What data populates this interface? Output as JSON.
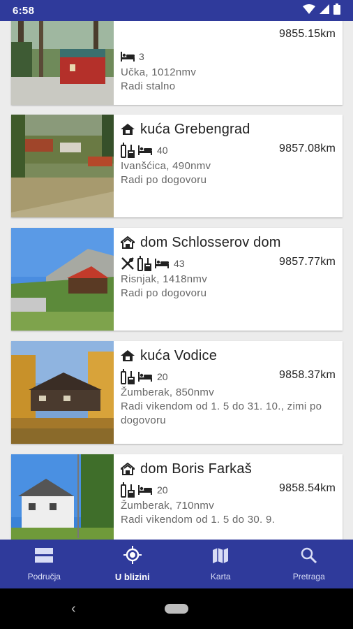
{
  "status_bar": {
    "time": "6:58"
  },
  "cards": [
    {
      "title": "",
      "amenities": [
        "bed"
      ],
      "beds": "3",
      "distance": "9855.15km",
      "location": "Učka, 1012nmv",
      "hours": "Radi stalno",
      "type_icon": "",
      "photo": "cabin-forest"
    },
    {
      "title": "kuća Grebengrad",
      "amenities": [
        "drinks",
        "bed"
      ],
      "beds": "40",
      "distance": "9857.08km",
      "location": "Ivanšćica, 490nmv",
      "hours": "Radi po dogovoru",
      "type_icon": "house-icon",
      "photo": "village-hills"
    },
    {
      "title": "dom Schlosserov dom",
      "amenities": [
        "food",
        "drinks",
        "bed"
      ],
      "beds": "43",
      "distance": "9857.77km",
      "location": "Risnjak, 1418nmv",
      "hours": "Radi po dogovoru",
      "type_icon": "lodge-icon",
      "photo": "mountain-hut"
    },
    {
      "title": "kuća Vodice",
      "amenities": [
        "drinks",
        "bed"
      ],
      "beds": "20",
      "distance": "9858.37km",
      "location": "Žumberak, 850nmv",
      "hours": "Radi vikendom od 1. 5 do 31. 10., zimi po dogovoru",
      "type_icon": "house-icon",
      "photo": "autumn-chalet"
    },
    {
      "title": "dom Boris Farkaš",
      "amenities": [
        "drinks",
        "bed"
      ],
      "beds": "20",
      "distance": "9858.54km",
      "location": "Žumberak, 710nmv",
      "hours": "Radi vikendom od 1. 5 do 30. 9.",
      "type_icon": "lodge-icon",
      "photo": "white-house"
    }
  ],
  "bottom_nav": {
    "items": [
      {
        "label": "Područja",
        "icon": "areas-icon"
      },
      {
        "label": "U blizini",
        "icon": "location-icon"
      },
      {
        "label": "Karta",
        "icon": "map-icon"
      },
      {
        "label": "Pretraga",
        "icon": "search-icon"
      }
    ],
    "active": "U blizini"
  }
}
